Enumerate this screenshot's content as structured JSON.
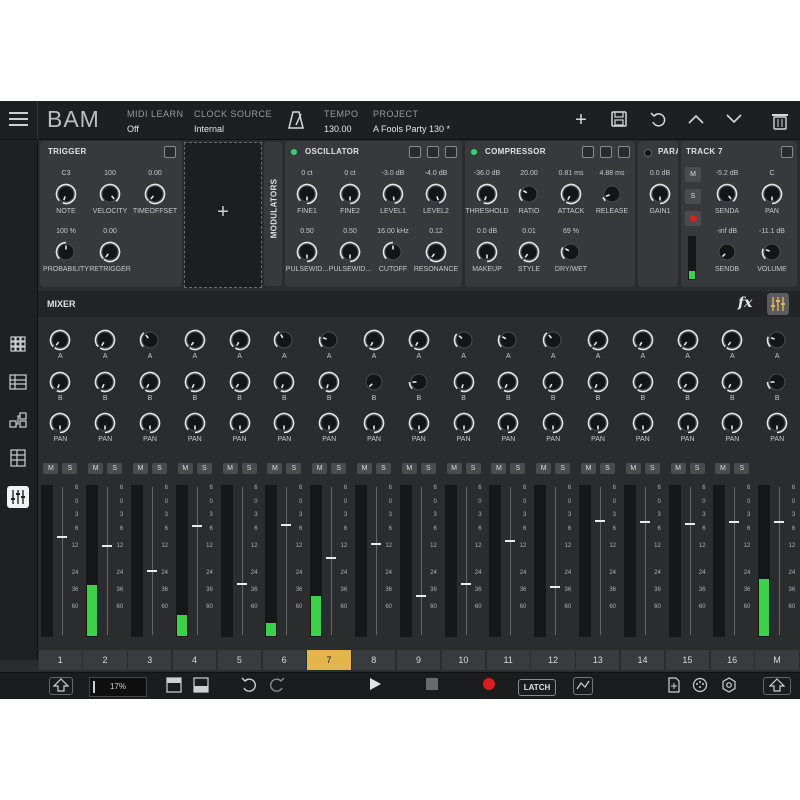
{
  "app": {
    "title": "BAM"
  },
  "topbar": {
    "midi_learn": {
      "label": "MIDI LEARN",
      "value": "Off"
    },
    "clock_source": {
      "label": "CLOCK SOURCE",
      "value": "Internal"
    },
    "tempo": {
      "label": "TEMPO",
      "value": "130.00"
    },
    "project": {
      "label": "PROJECT",
      "value": "A Fools Party 130 *"
    },
    "icons": [
      "menu-icon",
      "metronome-icon",
      "add-icon",
      "save-icon",
      "undo-icon",
      "chevron-up-icon",
      "chevron-down-icon",
      "trash-icon"
    ]
  },
  "panels": {
    "trigger": {
      "title": "TRIGGER",
      "knobs": [
        {
          "value": "C3",
          "label": "NOTE"
        },
        {
          "value": "100",
          "label": "VELOCITY"
        },
        {
          "value": "0.00",
          "label": "TIMEOFFSET"
        },
        {
          "value": "100 %",
          "label": "PROBABILITY"
        },
        {
          "value": "0.00",
          "label": "RETRIGGER"
        }
      ]
    },
    "modulators": {
      "label": "MODULATORS"
    },
    "oscillator": {
      "title": "OSCILLATOR",
      "knobs": [
        {
          "value": "0 ct",
          "label": "FINE1"
        },
        {
          "value": "0 ct",
          "label": "FINE2"
        },
        {
          "value": "-3.0 dB",
          "label": "LEVEL1"
        },
        {
          "value": "-4.0 dB",
          "label": "LEVEL2"
        },
        {
          "value": "0.50",
          "label": "PULSEWID..."
        },
        {
          "value": "0.50",
          "label": "PULSEWID..."
        },
        {
          "value": "16.00 kHz",
          "label": "CUTOFF"
        },
        {
          "value": "0.12",
          "label": "RESONANCE"
        }
      ]
    },
    "compressor": {
      "title": "COMPRESSOR",
      "knobs": [
        {
          "value": "-36.0 dB",
          "label": "THRESHOLD"
        },
        {
          "value": "20.00",
          "label": "RATIO"
        },
        {
          "value": "0.81 ms",
          "label": "ATTACK"
        },
        {
          "value": "4.88 ms",
          "label": "RELEASE"
        },
        {
          "value": "0.0 dB",
          "label": "MAKEUP"
        },
        {
          "value": "0.01",
          "label": "STYLE"
        },
        {
          "value": "69 %",
          "label": "DRY/WET"
        }
      ]
    },
    "param": {
      "title": "PARA",
      "knobs": [
        {
          "value": "0.0 dB",
          "label": "GAIN1"
        }
      ]
    },
    "track": {
      "title": "TRACK 7",
      "buttons": {
        "mute": "M",
        "solo": "S"
      },
      "knobs": [
        {
          "value": "-5.2 dB",
          "label": "SENDA"
        },
        {
          "value": "C",
          "label": "PAN"
        },
        {
          "value": "-inf dB",
          "label": "SENDB"
        },
        {
          "value": "-11.1 dB",
          "label": "VOLUME"
        }
      ],
      "meter_level": 0.2
    }
  },
  "mixer": {
    "title": "MIXER",
    "fx_label": "fx",
    "row_labels": {
      "a": "A",
      "b": "B",
      "pan": "PAN"
    },
    "mute_label": "M",
    "solo_label": "S",
    "scale": [
      "6",
      "0",
      "3",
      "6",
      "12",
      "24",
      "36",
      "60"
    ],
    "channels": [
      "1",
      "2",
      "3",
      "4",
      "5",
      "6",
      "7",
      "8",
      "9",
      "10",
      "11",
      "12",
      "13",
      "14",
      "15",
      "16",
      "M"
    ],
    "selected_channel": "7",
    "meter_levels": [
      0,
      0.34,
      0,
      0.14,
      0,
      0.09,
      0.27,
      0,
      0,
      0,
      0,
      0,
      0,
      0,
      0,
      0,
      0.38
    ],
    "fader_levels": [
      0.67,
      0.61,
      0.44,
      0.74,
      0.35,
      0.75,
      0.53,
      0.62,
      0.27,
      0.35,
      0.64,
      0.33,
      0.78,
      0.77,
      0.76,
      0.77,
      0.77
    ]
  },
  "bottombar": {
    "zoom": "17%",
    "latch": "LATCH"
  }
}
